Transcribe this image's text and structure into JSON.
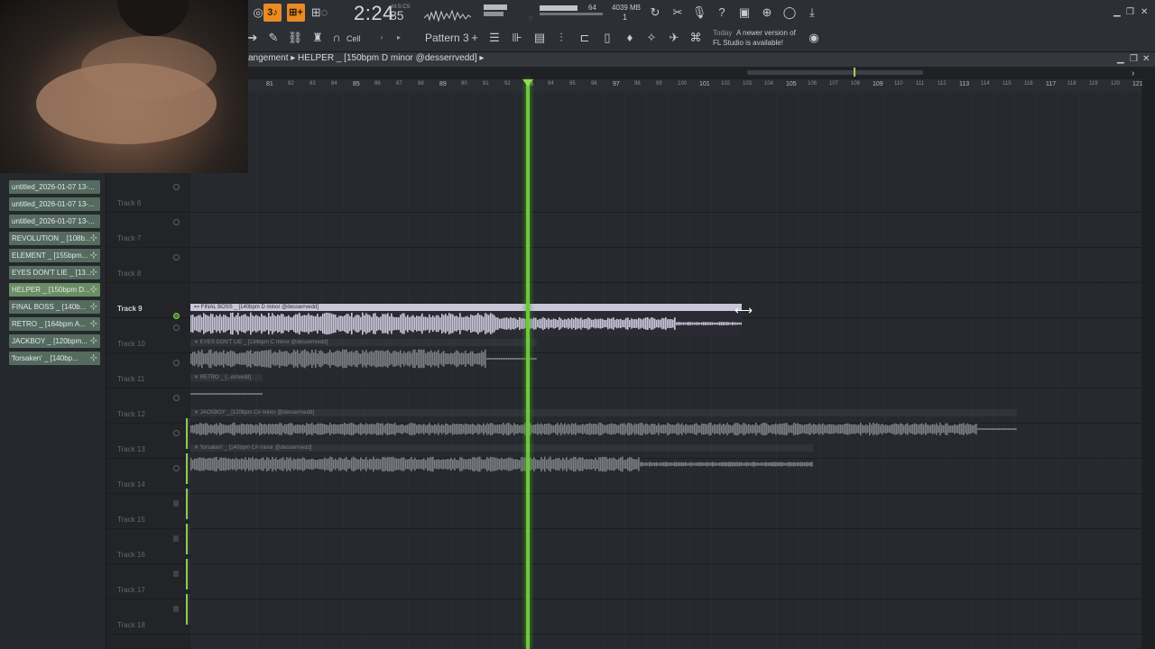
{
  "toolbar": {
    "time": "2:24",
    "time_sub": "85",
    "time_unit": "M:S:CS",
    "cpu": "64",
    "memory": "4039 MB",
    "polyphony": "1",
    "tool_label": "Cell",
    "pattern": "Pattern 3",
    "news_date": "Today",
    "news_text": "A newer version of",
    "news_text2": "FL Studio is available!",
    "icons": [
      "record-icon",
      "metronome-icon",
      "loop-icon",
      "undo-icon",
      "cut-icon",
      "microphone-icon",
      "help-icon",
      "save-icon",
      "plugin-icon",
      "chat-icon",
      "download-icon"
    ]
  },
  "playlist": {
    "breadcrumb": "angement ▸ HELPER _ [150bpm D minor @desserrvedd] ▸",
    "ruler": [
      "81",
      "82",
      "83",
      "84",
      "85",
      "86",
      "87",
      "88",
      "89",
      "90",
      "91",
      "92",
      "93",
      "94",
      "95",
      "96",
      "97",
      "98",
      "99",
      "100",
      "101",
      "102",
      "103",
      "104",
      "105",
      "106",
      "107",
      "108",
      "109",
      "110",
      "111",
      "112",
      "113",
      "114",
      "115",
      "116",
      "117",
      "118",
      "119",
      "120",
      "121"
    ]
  },
  "browser": {
    "items": [
      {
        "label": "untitled_2026-01-07 13-..."
      },
      {
        "label": "untitled_2026-01-07 13-..."
      },
      {
        "label": "untitled_2026-01-07 13-..."
      },
      {
        "label": "REVOLUTION _ [108b..."
      },
      {
        "label": "ELEMENT _ [155bpm..."
      },
      {
        "label": "EYES DON'T LIE _ [13..."
      },
      {
        "label": "HELPER _ [150bpm D..."
      },
      {
        "label": "FINAL BOSS _ [140b..."
      },
      {
        "label": "RETRO _ [164bpm A..."
      },
      {
        "label": "JACKBOY _ [120bpm..."
      },
      {
        "label": "'forsaken' _ [140bp..."
      }
    ]
  },
  "tracks": [
    {
      "label": "Track 6"
    },
    {
      "label": "Track 7"
    },
    {
      "label": "Track 8"
    },
    {
      "label": "Track 9"
    },
    {
      "label": "Track 10"
    },
    {
      "label": "Track 11"
    },
    {
      "label": "Track 12"
    },
    {
      "label": "Track 13"
    },
    {
      "label": "Track 14"
    },
    {
      "label": "Track 15"
    },
    {
      "label": "Track 16"
    },
    {
      "label": "Track 17"
    },
    {
      "label": "Track 18"
    }
  ],
  "clips": [
    {
      "title": "⊷ FINAL BOSS _ [140bpm D minor @desserrvedd]"
    },
    {
      "title": "✕ EYES DON'T LIE _ [134bpm C minor @desserrvedd]"
    },
    {
      "title": "✕ RETRO _ [...errvedd]"
    },
    {
      "title": "✕ JACKBOY _ [120bpm C# minor @desserrvedd]"
    },
    {
      "title": "✕ 'forsaken' _ [140bpm C# minor @desserrvedd]"
    }
  ],
  "colors": {
    "accent": "#e98a24",
    "playhead": "#6dc93a",
    "clip_active": "#c9c6d8",
    "clip_muted": "#7b7e83"
  }
}
